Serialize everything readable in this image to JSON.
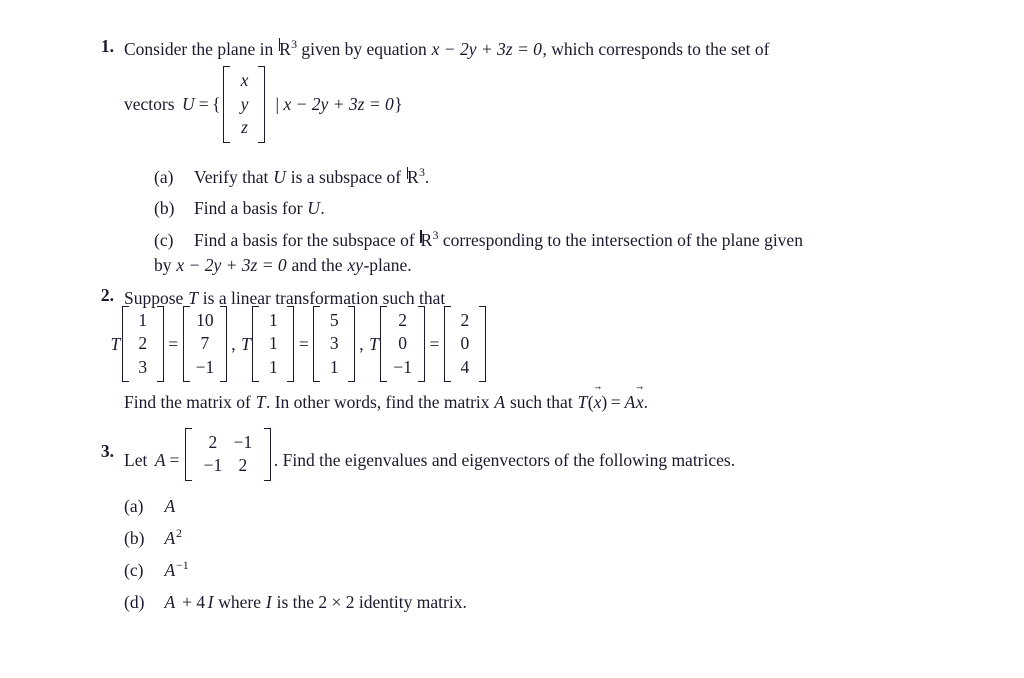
{
  "document": {
    "type": "linear-algebra-problem-set",
    "background_color": "#ffffff",
    "text_color": "#1a1a2e"
  },
  "problems": [
    {
      "number": "1.",
      "intro_part1": "Consider the plane in",
      "intro_R": "R",
      "intro_R_exp": "3",
      "intro_part2": "given by equation",
      "equation": "x − 2y + 3z = 0",
      "intro_part3": ", which corresponds to the set of",
      "line2_prefix": "vectors",
      "line2_U": "U",
      "line2_eq": "=",
      "line2_brace_open": "{",
      "vector_entries": [
        "x",
        "y",
        "z"
      ],
      "line2_condition_bar": "|",
      "line2_condition": "x − 2y + 3z = 0",
      "line2_brace_close": "}",
      "subitems": [
        {
          "label": "(a)",
          "text_a": "Verify that",
          "sym": "U",
          "text_b": "is a subspace of",
          "R": "R",
          "R_exp": "3",
          "text_c": "."
        },
        {
          "label": "(b)",
          "text_a": "Find a basis for",
          "sym": "U",
          "text_c": "."
        },
        {
          "label": "(c)",
          "text_a": "Find a basis for the subspace of",
          "R": "R",
          "R_exp": "3",
          "text_b": "corresponding to the intersection of the plane given",
          "line2_a": "by",
          "line2_eq": "x − 2y + 3z = 0",
          "line2_b": "and the",
          "line2_xy": "xy",
          "line2_c": "-plane."
        }
      ]
    },
    {
      "number": "2.",
      "intro_a": "Suppose",
      "intro_T": "T",
      "intro_b": "is a linear transformation such that",
      "transformations": [
        {
          "op": "T",
          "input": [
            "1",
            "2",
            "3"
          ],
          "equals": "=",
          "output": [
            "10",
            "7",
            "−1"
          ],
          "separator": ","
        },
        {
          "op": "T",
          "input": [
            "1",
            "1",
            "1"
          ],
          "equals": "=",
          "output": [
            "5",
            "3",
            "1"
          ],
          "separator": ","
        },
        {
          "op": "T",
          "input": [
            "2",
            "0",
            "−1"
          ],
          "equals": "=",
          "output": [
            "2",
            "0",
            "4"
          ],
          "separator": ""
        }
      ],
      "conclusion_a": "Find the matrix of",
      "conclusion_T": "T",
      "conclusion_b": ". In other words, find the matrix",
      "conclusion_A": "A",
      "conclusion_c": "such that",
      "conclusion_Tx": "T",
      "conclusion_vec": "x",
      "conclusion_eq": "=",
      "conclusion_Ax_A": "A",
      "conclusion_Ax_x": "x",
      "conclusion_period": "."
    },
    {
      "number": "3.",
      "intro_a": "Let",
      "intro_A": "A",
      "intro_eq": "=",
      "matrix_rows": [
        [
          "2",
          "−1"
        ],
        [
          "−1",
          "2"
        ]
      ],
      "intro_b": ". Find the eigenvalues and eigenvectors of the following matrices.",
      "subitems": [
        {
          "label": "(a)",
          "expr": "A",
          "exp": ""
        },
        {
          "label": "(b)",
          "expr": "A",
          "exp": "2"
        },
        {
          "label": "(c)",
          "expr": "A",
          "exp": "−1"
        },
        {
          "label": "(d)",
          "expr": "A",
          "plus": "+ 4",
          "I": "I",
          "text_a": "where",
          "I2": "I",
          "text_b": "is the 2 × 2 identity matrix."
        }
      ]
    }
  ]
}
